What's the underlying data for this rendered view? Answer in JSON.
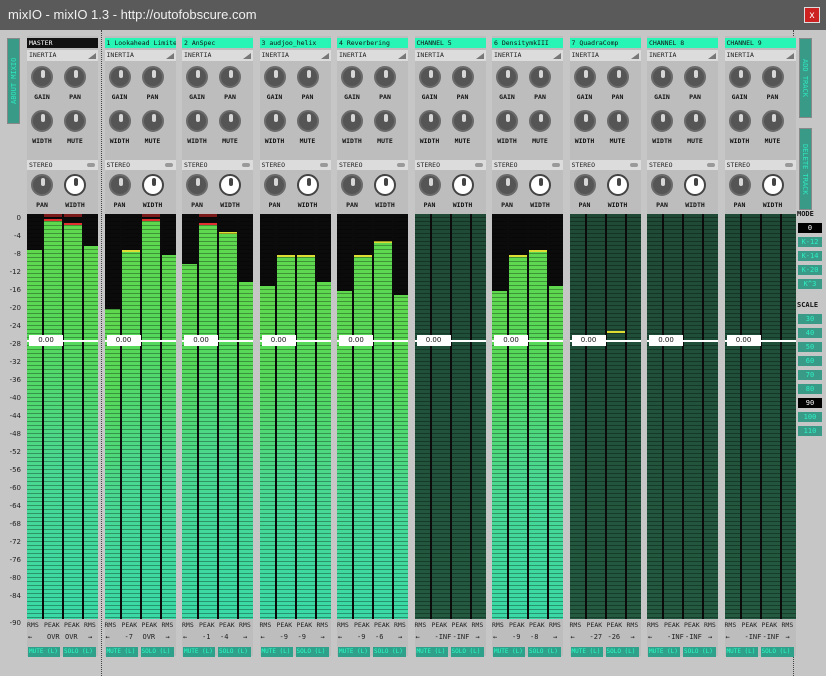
{
  "window": {
    "title": "mixIO - mixIO 1.3 - http://outofobscure.com",
    "close": "x"
  },
  "side": {
    "about": "ABOUT MIXIO",
    "add": "ADD TRACK",
    "delete": "DELETE TRACK"
  },
  "scale_labels": [
    "0",
    "-4",
    "-8",
    "-12",
    "-16",
    "-20",
    "-24",
    "-28",
    "-32",
    "-36",
    "-40",
    "-44",
    "-48",
    "-52",
    "-56",
    "-60",
    "-64",
    "-68",
    "-72",
    "-76",
    "-80",
    "-84",
    "-90"
  ],
  "labels": {
    "inertia": "INERTIA",
    "stereo": "STEREO",
    "gain": "GAIN",
    "pan": "PAN",
    "width": "WIDTH",
    "mute": "MUTE",
    "rms": "RMS",
    "peak": "PEAK",
    "left": "←",
    "right": "→"
  },
  "channels": [
    {
      "name": "MASTER",
      "master": true,
      "fader": "0.00",
      "rmsL": -8,
      "peakL": -1,
      "peakR": -2,
      "rmsR": -7,
      "vL": "OVR",
      "vR": "OVR",
      "mute": "MUTE (L)",
      "solo": "SOLO (L)",
      "dark": false
    },
    {
      "name": "1 Lookahead Limiter",
      "fader": "0.00",
      "rmsL": -21,
      "peakL": -8,
      "peakR": -1,
      "rmsR": -9,
      "vL": "-7",
      "vR": "OVR",
      "mute": "MUTE (L)",
      "solo": "SOLO (L)",
      "dark": false
    },
    {
      "name": "2 AnSpec",
      "fader": "0.00",
      "rmsL": -11,
      "peakL": -2,
      "peakR": -4,
      "rmsR": -15,
      "vL": "-1",
      "vR": "-4",
      "mute": "MUTE (L)",
      "solo": "SOLO (L)",
      "dark": false
    },
    {
      "name": "3 audjoo_helix",
      "fader": "0.00",
      "rmsL": -16,
      "peakL": -9,
      "peakR": -9,
      "rmsR": -15,
      "vL": "-9",
      "vR": "-9",
      "mute": "MUTE (L)",
      "solo": "SOLO (L)",
      "dark": false
    },
    {
      "name": "4 Reverbering",
      "fader": "0.00",
      "rmsL": -17,
      "peakL": -9,
      "peakR": -6,
      "rmsR": -18,
      "vL": "-9",
      "vR": "-6",
      "mute": "MUTE (L)",
      "solo": "SOLO (L)",
      "dark": false
    },
    {
      "name": "CHANNEL 5",
      "fader": "0.00",
      "rmsL": -90,
      "peakL": -90,
      "peakR": -90,
      "rmsR": -90,
      "vL": "-INF",
      "vR": "-INF",
      "mute": "MUTE (L)",
      "solo": "SOLO (L)",
      "dark": true
    },
    {
      "name": "6 DensitymkIII",
      "fader": "0.00",
      "rmsL": -17,
      "peakL": -9,
      "peakR": -8,
      "rmsR": -16,
      "vL": "-9",
      "vR": "-8",
      "mute": "MUTE (L)",
      "solo": "SOLO (L)",
      "dark": false
    },
    {
      "name": "7 QuadraComp",
      "fader": "0.00",
      "rmsL": -90,
      "peakL": -27,
      "peakR": -26,
      "rmsR": -90,
      "vL": "-27",
      "vR": "-26",
      "mute": "MUTE (L)",
      "solo": "SOLO (L)",
      "dark": true
    },
    {
      "name": "CHANNEL 8",
      "fader": "0.00",
      "rmsL": -90,
      "peakL": -90,
      "peakR": -90,
      "rmsR": -90,
      "vL": "-INF",
      "vR": "-INF",
      "mute": "MUTE (L)",
      "solo": "SOLO (L)",
      "dark": true
    },
    {
      "name": "CHANNEL 9",
      "fader": "0.00",
      "rmsL": -90,
      "peakL": -90,
      "peakR": -90,
      "rmsR": -90,
      "vL": "-INF",
      "vR": "-INF",
      "mute": "MUTE (L)",
      "solo": "SOLO (L)",
      "dark": true
    }
  ],
  "mode": {
    "title": "MODE",
    "items": [
      "0",
      "K-12",
      "K-14",
      "K-20",
      "K^3"
    ],
    "selected": 0
  },
  "scale": {
    "title": "SCALE",
    "items": [
      "30",
      "40",
      "50",
      "60",
      "70",
      "80",
      "90",
      "100",
      "110"
    ],
    "selected": 6
  },
  "meter_range": {
    "min": -90,
    "max": 0
  }
}
